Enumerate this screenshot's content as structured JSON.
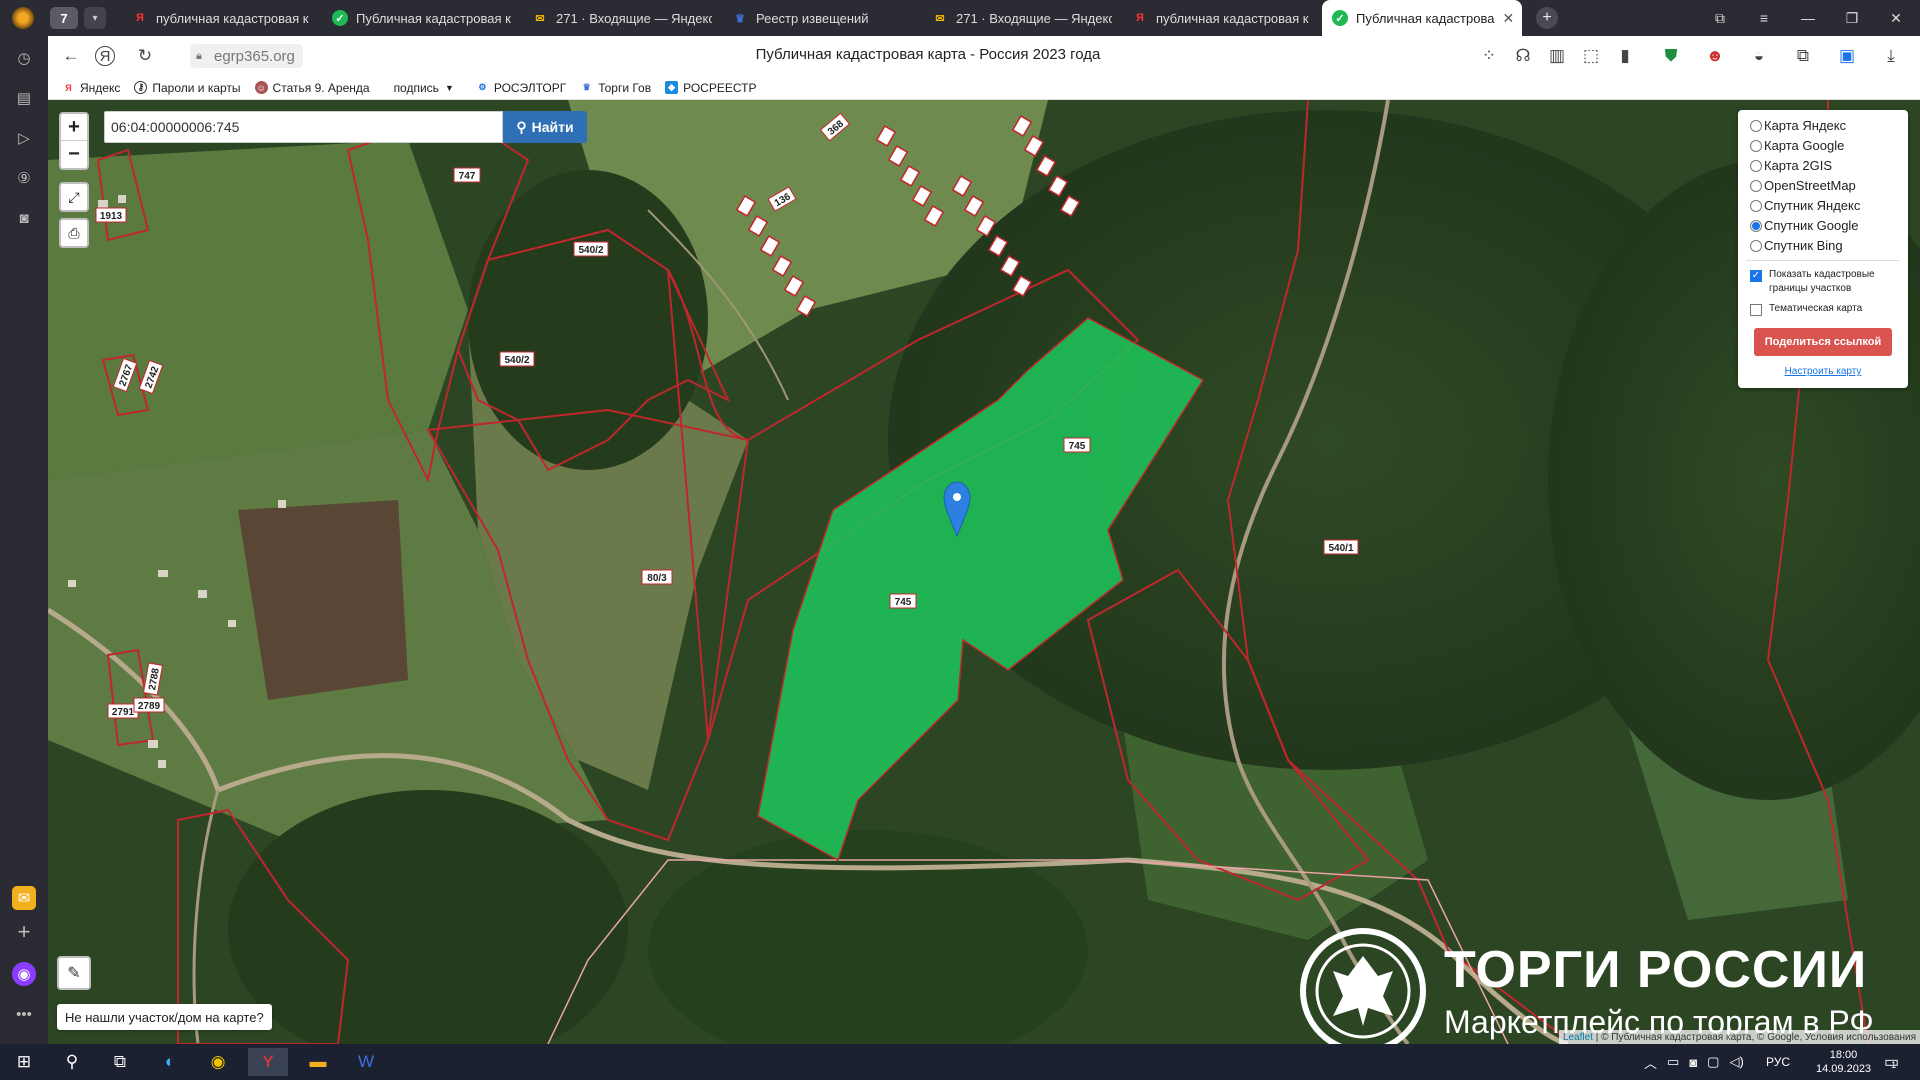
{
  "browser": {
    "tab_count": "7",
    "tabs": [
      {
        "title": "публичная кадастровая к",
        "icon": "yandex-icon",
        "active": false
      },
      {
        "title": "Публичная кадастровая к",
        "icon": "check-icon",
        "active": false
      },
      {
        "title": "271 · Входящие — Яндекс",
        "icon": "mail-icon",
        "active": false
      },
      {
        "title": "Реестр извещений",
        "icon": "eagle-icon",
        "active": false
      },
      {
        "title": "271 · Входящие — Яндекс",
        "icon": "mail-icon",
        "active": false
      },
      {
        "title": "публичная кадастровая к",
        "icon": "yandex-icon",
        "active": false
      },
      {
        "title": "Публичная кадастрова",
        "icon": "check-icon",
        "active": true
      }
    ],
    "url": "egrp365.org",
    "page_title": "Публичная кадастровая карта - Россия 2023 года",
    "bookmarks": [
      {
        "label": "Яндекс",
        "icon": "yandex-icon"
      },
      {
        "label": "Пароли и карты",
        "icon": "key-icon"
      },
      {
        "label": "Статья 9. Аренда",
        "icon": "avatar-icon"
      },
      {
        "label": "подпись",
        "icon": "chevron-down-icon"
      },
      {
        "label": "РОСЭЛТОРГ",
        "icon": "roseltorg-icon"
      },
      {
        "label": "Торги Гов",
        "icon": "eagle-icon"
      },
      {
        "label": "РОСРЕЕСТР",
        "icon": "rosreestr-icon"
      }
    ]
  },
  "map": {
    "search_value": "06:04:00000006:745",
    "search_button": "Найти",
    "zoom_in": "+",
    "zoom_out": "−",
    "layers": [
      {
        "label": "Карта Яндекс",
        "selected": false
      },
      {
        "label": "Карта Google",
        "selected": false
      },
      {
        "label": "Карта 2GIS",
        "selected": false
      },
      {
        "label": "OpenStreetMap",
        "selected": false
      },
      {
        "label": "Спутник Яндекс",
        "selected": false
      },
      {
        "label": "Спутник Google",
        "selected": true
      },
      {
        "label": "Спутник Bing",
        "selected": false
      }
    ],
    "show_boundaries_label": "Показать кадастровые границы участков",
    "show_boundaries_checked": true,
    "thematic_label": "Тематическая карта",
    "thematic_checked": false,
    "share_button": "Поделиться ссылкой",
    "configure_link": "Настроить карту",
    "not_found_label": "Не нашли участок/дом на карте?",
    "attribution_leaflet": "Leaflet",
    "attribution_rest": "| © Публичная кадастровая карта, © Google, Условия использования",
    "parcel_labels": [
      "747",
      "540/2",
      "540/2",
      "745",
      "745",
      "80/3",
      "540/1",
      "1913",
      "2767",
      "2742",
      "2788",
      "2791",
      "2789",
      "368",
      "136"
    ],
    "highlight_color": "#1fc35a",
    "boundary_color": "#c0272d",
    "watermark_title": "ТОРГИ РОССИИ",
    "watermark_subtitle": "Маркетплейс по торгам в РФ"
  },
  "taskbar": {
    "lang": "РУС",
    "time": "18:00",
    "date": "14.09.2023",
    "notifications": "1"
  }
}
